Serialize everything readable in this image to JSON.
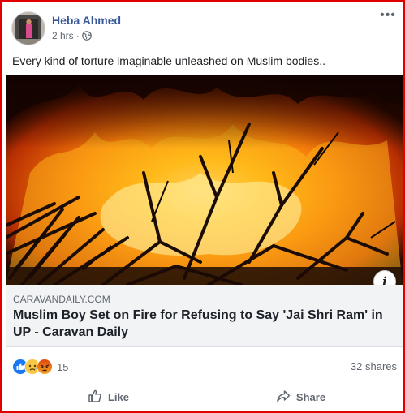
{
  "post": {
    "author": "Heba Ahmed",
    "time": "2 hrs",
    "separator": "·",
    "privacy_icon": "globe-icon",
    "more_icon": "more-options-icon",
    "more_glyph": "•••",
    "caption": "Every kind of torture imaginable unleashed on Muslim bodies.."
  },
  "link": {
    "domain": "CARAVANDAILY.COM",
    "title": "Muslim Boy Set on Fire for Refusing to Say 'Jai Shri Ram' in UP - Caravan Daily",
    "info_glyph": "i"
  },
  "stats": {
    "reaction_icons": [
      "like-reaction-icon",
      "sad-reaction-icon",
      "angry-reaction-icon"
    ],
    "reaction_count": "15",
    "shares": "32 shares"
  },
  "actions": {
    "like_label": "Like",
    "share_label": "Share"
  },
  "colors": {
    "frame_border": "#e00000",
    "author_link": "#385898",
    "like_blue": "#1877f2",
    "sad_yellow": "#f7c844",
    "angry_orange": "#e9710f"
  }
}
